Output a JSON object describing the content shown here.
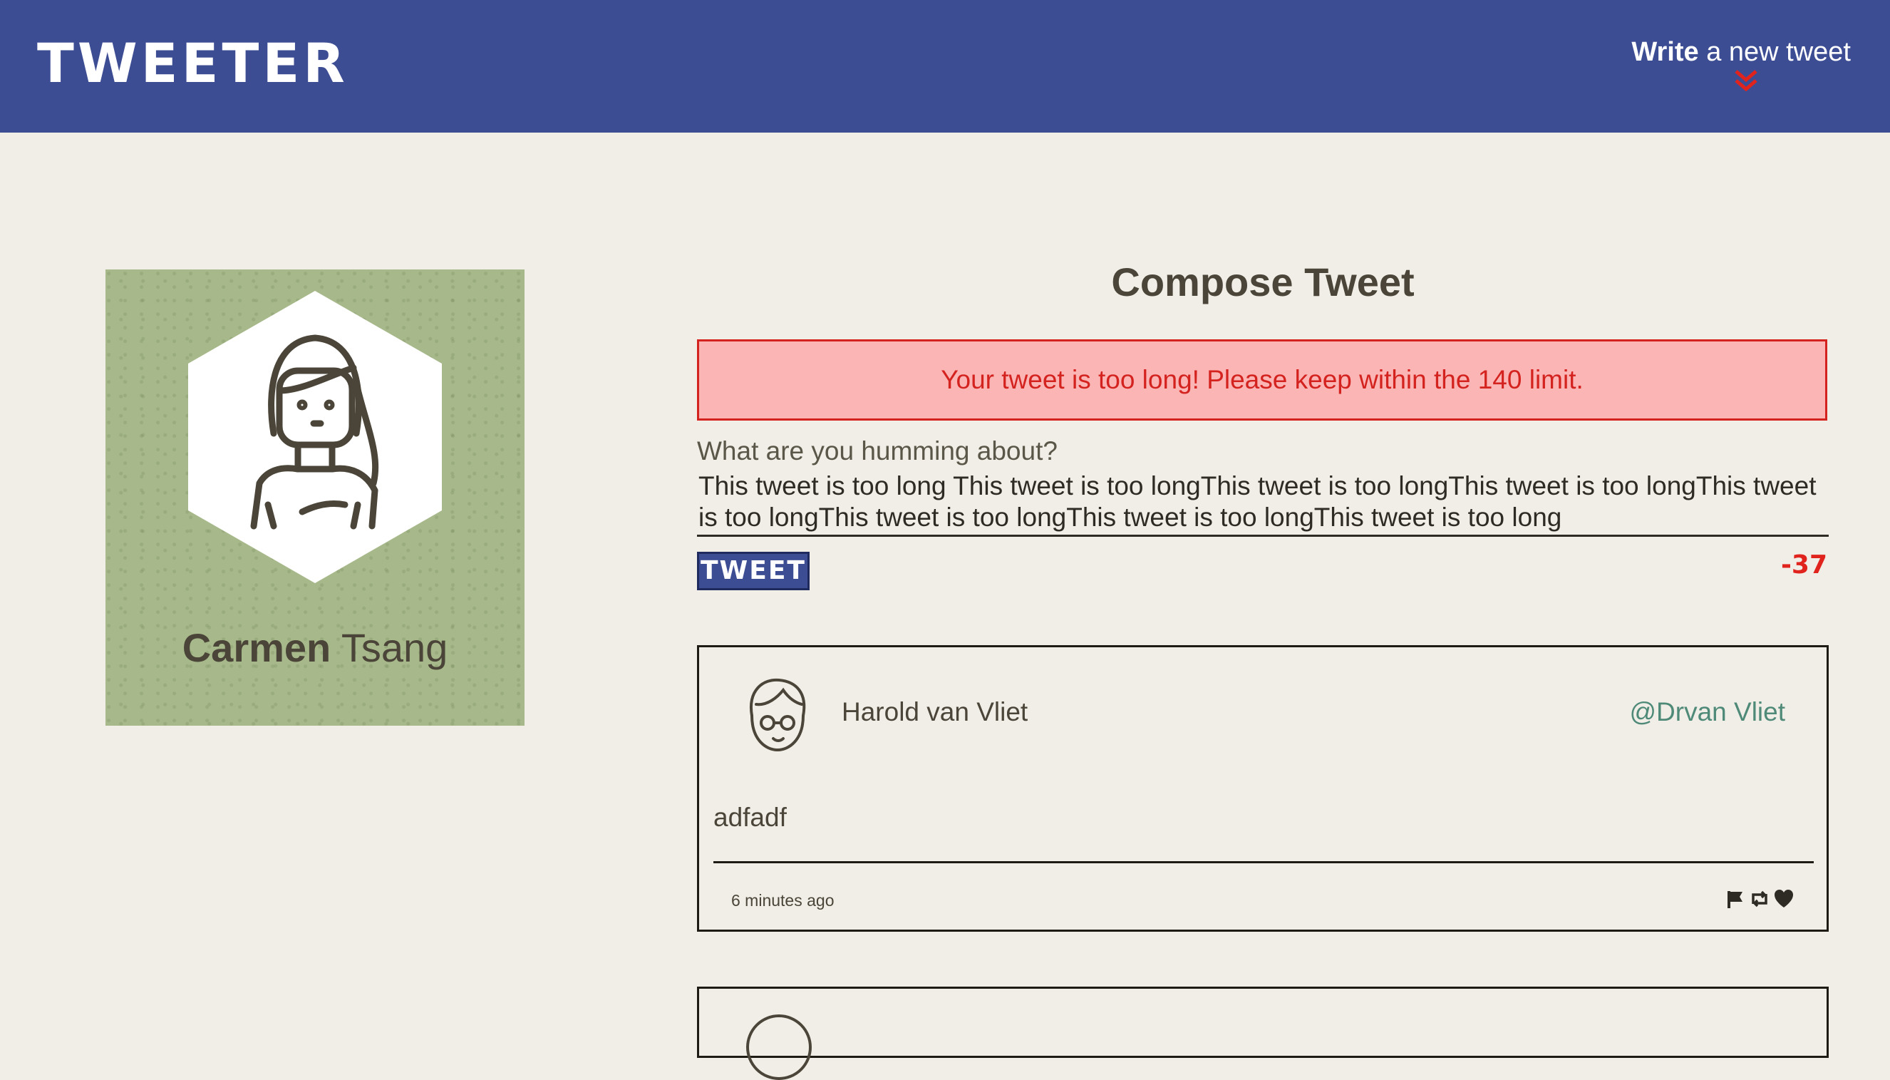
{
  "nav": {
    "brand": "TWEETER",
    "write_bold": "Write",
    "write_rest": "a new tweet",
    "accent": "#e0241d",
    "background": "#3d4d94"
  },
  "profile": {
    "first_name": "Carmen",
    "last_name": "Tsang",
    "background": "#a7b98a",
    "avatar_icon": "woman-avatar-icon"
  },
  "compose": {
    "title": "Compose Tweet",
    "error": "Your tweet is too long! Please keep within the 140 limit.",
    "label": "What are you humming about?",
    "text": "This tweet is too long This tweet is too longThis tweet is too longThis tweet is too longThis tweet is too longThis tweet is too longThis tweet is too longThis tweet is too long",
    "button": "TWEET",
    "counter": "-37"
  },
  "tweets": [
    {
      "name": "Harold van Vliet",
      "handle": "@Drvan Vliet",
      "body": "adfadf",
      "time": "6 minutes ago",
      "actions": [
        "flag-icon",
        "retweet-icon",
        "heart-icon"
      ]
    }
  ]
}
